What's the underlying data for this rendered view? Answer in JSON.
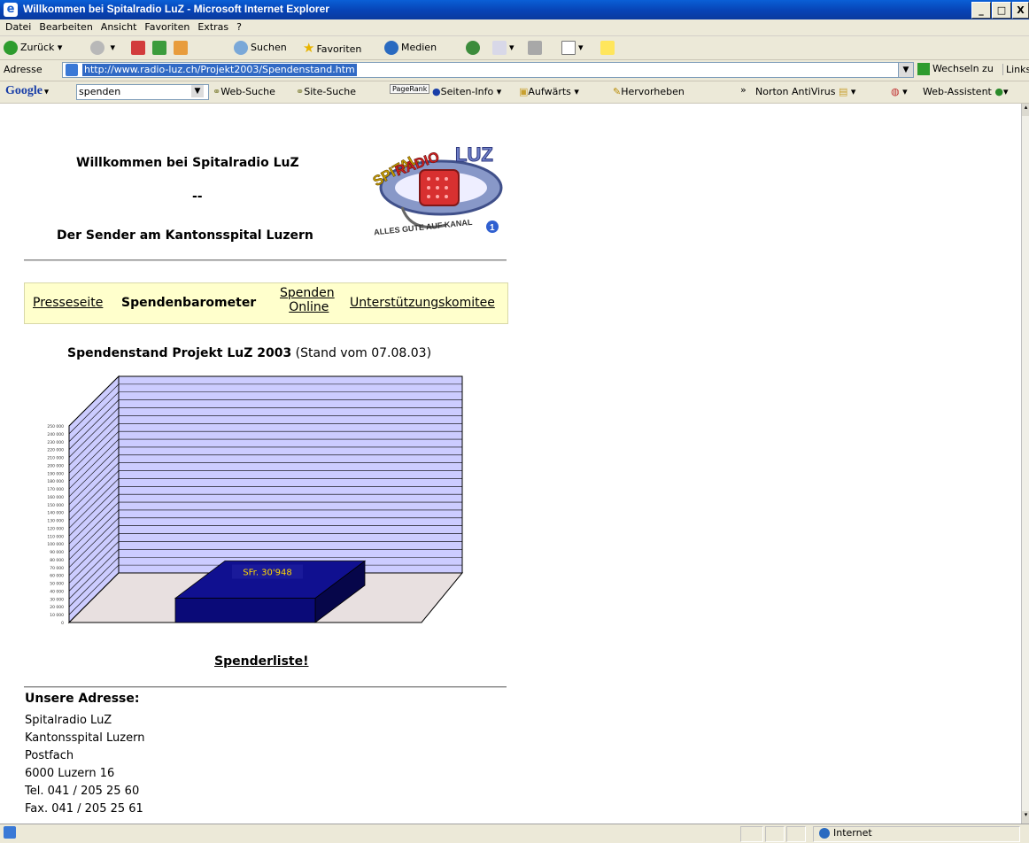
{
  "window": {
    "title": "Willkommen bei Spitalradio LuZ - Microsoft Internet Explorer",
    "icon": "ie-icon"
  },
  "menu": [
    "Datei",
    "Bearbeiten",
    "Ansicht",
    "Favoriten",
    "Extras",
    "?"
  ],
  "toolbar": {
    "back": "Zurück",
    "search": "Suchen",
    "favorites": "Favoriten",
    "media": "Medien"
  },
  "address": {
    "label": "Adresse",
    "url": "http://www.radio-luz.ch/Projekt2003/Spendenstand.htm",
    "go": "Wechseln zu",
    "links": "Links"
  },
  "google_bar": {
    "brand": "Google",
    "query": "spenden",
    "web_search": "Web-Suche",
    "site_search": "Site-Suche",
    "pagerank": "PageRank",
    "page_info": "Seiten-Info",
    "up": "Aufwärts",
    "highlight": "Hervorheben",
    "norton": "Norton AntiVirus",
    "web_assistant": "Web-Assistent"
  },
  "page": {
    "welcome": "Willkommen bei Spitalradio LuZ",
    "dash": "--",
    "subtitle": "Der Sender am Kantonsspital Luzern",
    "logo_text": {
      "spital": "SPITAL",
      "radio": "RADIO",
      "luz": "LUZ",
      "slogan": "ALLES GUTE AUF KANAL",
      "channel": "1"
    },
    "nav": [
      {
        "label": "Presseseite",
        "link": true
      },
      {
        "label": "Spendenbarometer",
        "link": false
      },
      {
        "label": "Spenden",
        "label2": "Online",
        "link": true
      },
      {
        "label": "Unterstützungskomitee",
        "link": true
      }
    ],
    "chart_heading": "Spendenstand Projekt LuZ 2003",
    "chart_heading_note": "(Stand vom 07.08.03)",
    "donor_list": "Spenderliste!",
    "address_heading": "Unsere Adresse:",
    "address_lines": [
      "Spitalradio LuZ",
      "Kantonsspital Luzern",
      "Postfach",
      "6000 Luzern 16",
      "Tel. 041 / 205 25 60",
      "Fax. 041 / 205 25 61"
    ]
  },
  "chart_data": {
    "type": "bar",
    "categories": [
      ""
    ],
    "values": [
      30948
    ],
    "data_labels": [
      "SFr. 30'948"
    ],
    "ylim": [
      0,
      250000
    ],
    "yticks": [
      "0",
      "10 000",
      "20 000",
      "30 000",
      "40 000",
      "50 000",
      "60 000",
      "70 000",
      "80 000",
      "90 000",
      "100 000",
      "110 000",
      "120 000",
      "130 000",
      "140 000",
      "150 000",
      "160 000",
      "170 000",
      "180 000",
      "190 000",
      "200 000",
      "210 000",
      "220 000",
      "230 000",
      "240 000",
      "250 000"
    ],
    "grid": true,
    "three_d": true,
    "colors": {
      "bar": "#0a0a78",
      "wall": "#ccccff",
      "label_bg": "#1a1a9a",
      "label_text": "#ffd700"
    }
  },
  "status": {
    "zone": "Internet"
  },
  "colors": {
    "titlebar": "#0743b5",
    "nav_bg": "#ffffcc",
    "url_highlight": "#316ac5"
  }
}
